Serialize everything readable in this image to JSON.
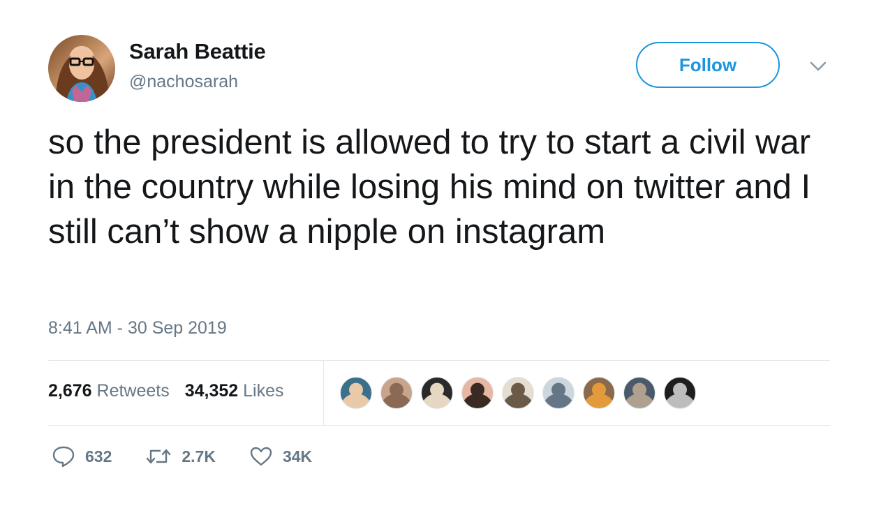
{
  "user": {
    "display_name": "Sarah Beattie",
    "handle": "@nachosarah"
  },
  "follow_button": {
    "label": "Follow"
  },
  "tweet": {
    "text": "so the president is allowed to try to start a civil war in the country while losing his mind on twitter and I still can’t show a nipple on instagram",
    "timestamp": "8:41 AM - 30 Sep 2019"
  },
  "stats": {
    "retweets_count": "2,676",
    "retweets_label": "Retweets",
    "likes_count": "34,352",
    "likes_label": "Likes"
  },
  "liker_avatars": [
    {
      "colors": [
        "#3c6f8a",
        "#e8c9a8"
      ]
    },
    {
      "colors": [
        "#c9a48c",
        "#8a6a55"
      ]
    },
    {
      "colors": [
        "#2a2a2a",
        "#e6d7c2"
      ]
    },
    {
      "colors": [
        "#e7b7a4",
        "#3a2b22"
      ]
    },
    {
      "colors": [
        "#e4ddd0",
        "#6b5a48"
      ]
    },
    {
      "colors": [
        "#ccd6dd",
        "#657786"
      ]
    },
    {
      "colors": [
        "#8a6a4a",
        "#e39a3a"
      ]
    },
    {
      "colors": [
        "#4a5a6a",
        "#b0a090"
      ]
    },
    {
      "colors": [
        "#1e1e1e",
        "#bdbdbd"
      ]
    }
  ],
  "actions": {
    "replies": "632",
    "retweets": "2.7K",
    "likes": "34K"
  },
  "icons": {
    "reply": "reply-icon",
    "retweet": "retweet-icon",
    "like": "heart-icon",
    "menu": "chevron-down-icon"
  },
  "colors": {
    "accent": "#1b95e0",
    "secondary_text": "#657786",
    "divider": "#e1e8ed"
  }
}
